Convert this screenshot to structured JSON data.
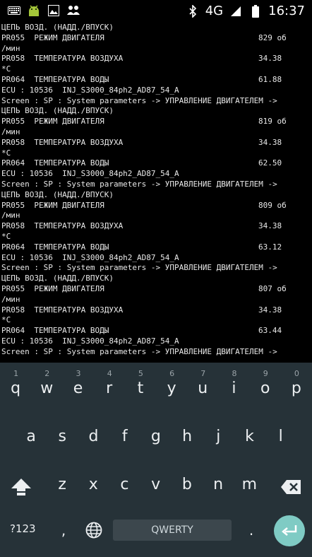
{
  "status_bar": {
    "network": "4G",
    "time": "16:37",
    "icons_left": [
      "keyboard-icon",
      "android-icon",
      "image-icon",
      "people-icon"
    ],
    "icons_right": [
      "bluetooth-icon",
      "signal-icon",
      "battery-icon"
    ]
  },
  "terminal": {
    "lines": [
      {
        "text": "ЦЕПЬ ВОЗД. (НАДД./ВПУСК)",
        "value": ""
      },
      {
        "text": "PR055  РЕЖИМ ДВИГАТЕЛЯ",
        "value": "829 об"
      },
      {
        "text": "/мин",
        "value": ""
      },
      {
        "text": "PR058  ТЕМПЕРАТУРА ВОЗДУХА",
        "value": "34.38"
      },
      {
        "text": "*C",
        "value": ""
      },
      {
        "text": "PR064  ТЕМПЕРАТУРА ВОДЫ",
        "value": "61.88"
      },
      {
        "text": "ECU : 10536  INJ_S3000_84ph2_AD87_54_A",
        "value": ""
      },
      {
        "text": "Screen : SP : System parameters -> УПРАВЛЕНИЕ ДВИГАТЕЛЕМ ->",
        "value": ""
      },
      {
        "text": "ЦЕПЬ ВОЗД. (НАДД./ВПУСК)",
        "value": ""
      },
      {
        "text": "PR055  РЕЖИМ ДВИГАТЕЛЯ",
        "value": "819 об"
      },
      {
        "text": "/мин",
        "value": ""
      },
      {
        "text": "PR058  ТЕМПЕРАТУРА ВОЗДУХА",
        "value": "34.38"
      },
      {
        "text": "*C",
        "value": ""
      },
      {
        "text": "PR064  ТЕМПЕРАТУРА ВОДЫ",
        "value": "62.50"
      },
      {
        "text": "ECU : 10536  INJ_S3000_84ph2_AD87_54_A",
        "value": ""
      },
      {
        "text": "Screen : SP : System parameters -> УПРАВЛЕНИЕ ДВИГАТЕЛЕМ ->",
        "value": ""
      },
      {
        "text": "ЦЕПЬ ВОЗД. (НАДД./ВПУСК)",
        "value": ""
      },
      {
        "text": "PR055  РЕЖИМ ДВИГАТЕЛЯ",
        "value": "809 об"
      },
      {
        "text": "/мин",
        "value": ""
      },
      {
        "text": "PR058  ТЕМПЕРАТУРА ВОЗДУХА",
        "value": "34.38"
      },
      {
        "text": "*C",
        "value": ""
      },
      {
        "text": "PR064  ТЕМПЕРАТУРА ВОДЫ",
        "value": "63.12"
      },
      {
        "text": "ECU : 10536  INJ_S3000_84ph2_AD87_54_A",
        "value": ""
      },
      {
        "text": "Screen : SP : System parameters -> УПРАВЛЕНИЕ ДВИГАТЕЛЕМ ->",
        "value": ""
      },
      {
        "text": "ЦЕПЬ ВОЗД. (НАДД./ВПУСК)",
        "value": ""
      },
      {
        "text": "PR055  РЕЖИМ ДВИГАТЕЛЯ",
        "value": "807 об"
      },
      {
        "text": "/мин",
        "value": ""
      },
      {
        "text": "PR058  ТЕМПЕРАТУРА ВОЗДУХА",
        "value": "34.38"
      },
      {
        "text": "*C",
        "value": ""
      },
      {
        "text": "PR064  ТЕМПЕРАТУРА ВОДЫ",
        "value": "63.44"
      },
      {
        "text": "ECU : 10536  INJ_S3000_84ph2_AD87_54_A",
        "value": ""
      },
      {
        "text": "Screen : SP : System parameters -> УПРАВЛЕНИЕ ДВИГАТЕЛЕМ ->",
        "value": ""
      }
    ]
  },
  "keyboard": {
    "row1": [
      "q",
      "w",
      "e",
      "r",
      "t",
      "y",
      "u",
      "i",
      "o",
      "p"
    ],
    "row1_hints": [
      "1",
      "2",
      "3",
      "4",
      "5",
      "6",
      "7",
      "8",
      "9",
      "0"
    ],
    "row2": [
      "a",
      "s",
      "d",
      "f",
      "g",
      "h",
      "j",
      "k",
      "l"
    ],
    "row3": [
      "z",
      "x",
      "c",
      "v",
      "b",
      "n",
      "m"
    ],
    "symbols_label": "?123",
    "comma_label": ",",
    "period_label": ".",
    "space_label": "QWERTY",
    "icons": [
      "shift-icon",
      "backspace-icon",
      "globe-icon",
      "enter-icon"
    ]
  }
}
